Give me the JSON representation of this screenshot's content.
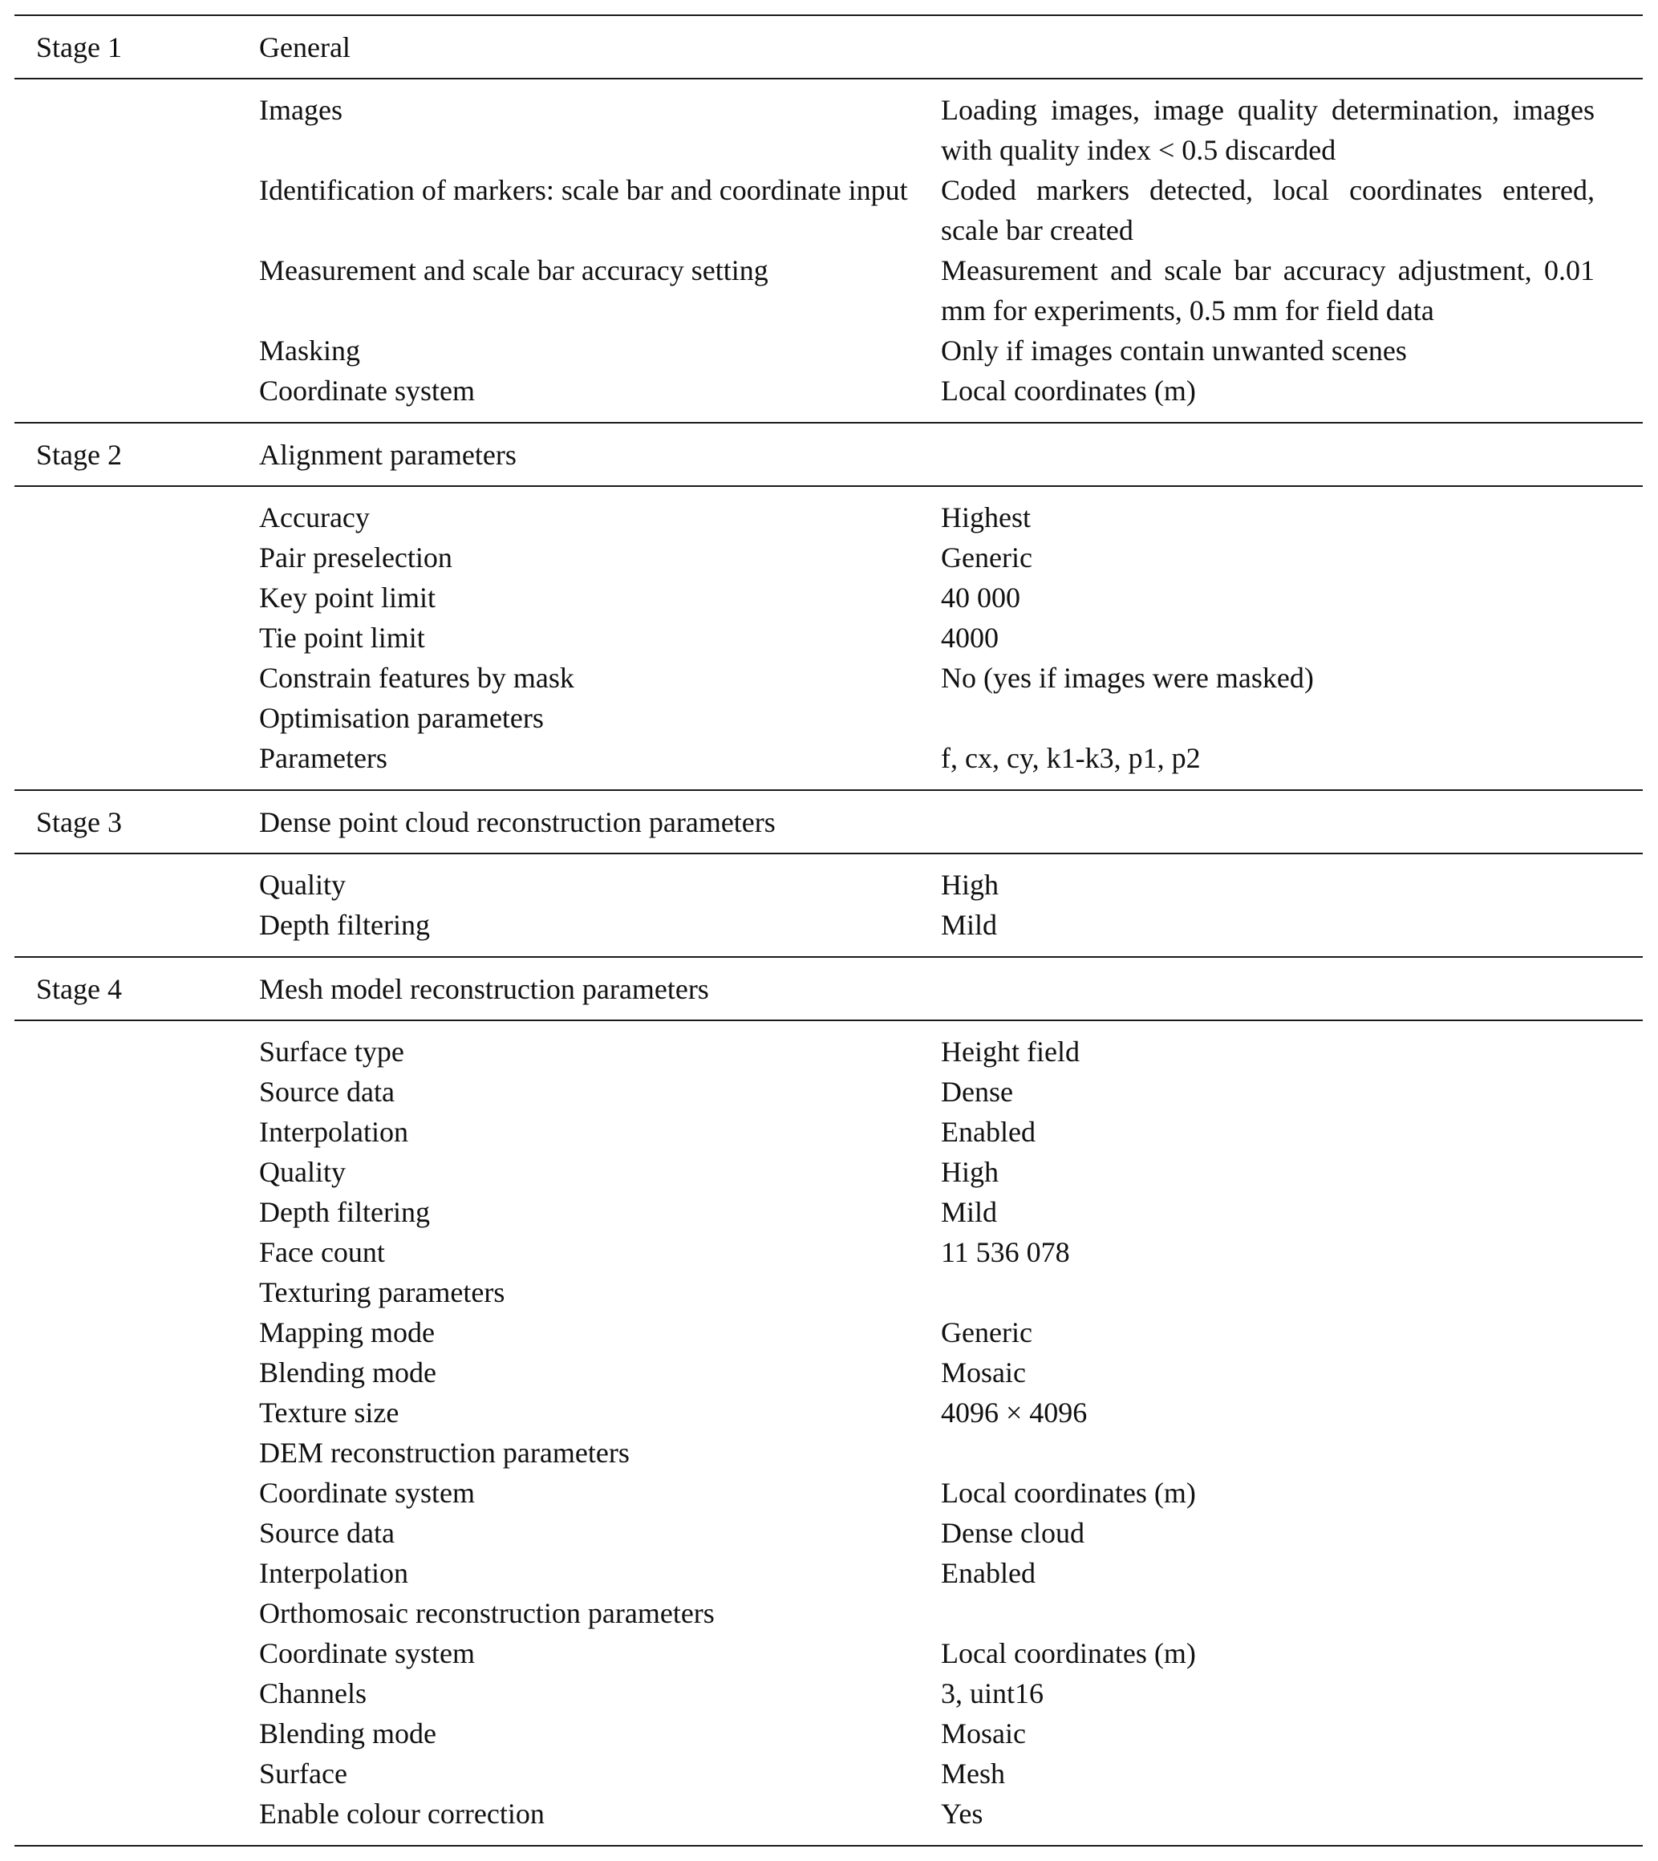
{
  "stages": [
    {
      "label": "Stage 1",
      "title": "General",
      "rows": [
        {
          "name": "Images",
          "value": "Loading images, image quality determination, images with quality index < 0.5 discarded"
        },
        {
          "name": "Identification of markers: scale bar and coordinate input",
          "value": "Coded markers detected, local coordinates entered, scale bar created"
        },
        {
          "name": "Measurement and scale bar accuracy setting",
          "value": "Measurement and scale bar accuracy adjustment, 0.01 mm for experiments, 0.5 mm for field data"
        },
        {
          "name": "Masking",
          "value": "Only if images contain unwanted scenes"
        },
        {
          "name": "Coordinate system",
          "value": "Local coordinates (m)"
        }
      ]
    },
    {
      "label": "Stage 2",
      "title": "Alignment parameters",
      "rows": [
        {
          "name": "Accuracy",
          "value": "Highest"
        },
        {
          "name": "Pair preselection",
          "value": "Generic"
        },
        {
          "name": "Key point limit",
          "value": "40 000"
        },
        {
          "name": "Tie point limit",
          "value": "4000"
        },
        {
          "name": "Constrain features by mask",
          "value": "No (yes if images were masked)"
        },
        {
          "name": "Optimisation parameters",
          "value": ""
        },
        {
          "name": "Parameters",
          "value": "f, cx, cy, k1-k3, p1, p2"
        }
      ]
    },
    {
      "label": "Stage 3",
      "title": "Dense point cloud reconstruction parameters",
      "rows": [
        {
          "name": "Quality",
          "value": "High"
        },
        {
          "name": "Depth filtering",
          "value": "Mild"
        }
      ]
    },
    {
      "label": "Stage 4",
      "title": "Mesh model reconstruction parameters",
      "rows": [
        {
          "name": "Surface type",
          "value": "Height field"
        },
        {
          "name": "Source data",
          "value": "Dense"
        },
        {
          "name": "Interpolation",
          "value": "Enabled"
        },
        {
          "name": "Quality",
          "value": "High"
        },
        {
          "name": "Depth filtering",
          "value": "Mild"
        },
        {
          "name": "Face count",
          "value": "11 536 078"
        },
        {
          "name": "Texturing parameters",
          "value": ""
        },
        {
          "name": "Mapping mode",
          "value": "Generic"
        },
        {
          "name": "Blending mode",
          "value": "Mosaic"
        },
        {
          "name": "Texture size",
          "value": "4096 × 4096"
        },
        {
          "name": "DEM reconstruction parameters",
          "value": ""
        },
        {
          "name": "Coordinate system",
          "value": "Local coordinates (m)"
        },
        {
          "name": "Source data",
          "value": "Dense cloud"
        },
        {
          "name": "Interpolation",
          "value": "Enabled"
        },
        {
          "name": "Orthomosaic reconstruction parameters",
          "value": ""
        },
        {
          "name": "Coordinate system",
          "value": "Local coordinates (m)"
        },
        {
          "name": "Channels",
          "value": "3, uint16"
        },
        {
          "name": "Blending mode",
          "value": "Mosaic"
        },
        {
          "name": "Surface",
          "value": "Mesh"
        },
        {
          "name": "Enable colour correction",
          "value": "Yes"
        }
      ]
    }
  ]
}
